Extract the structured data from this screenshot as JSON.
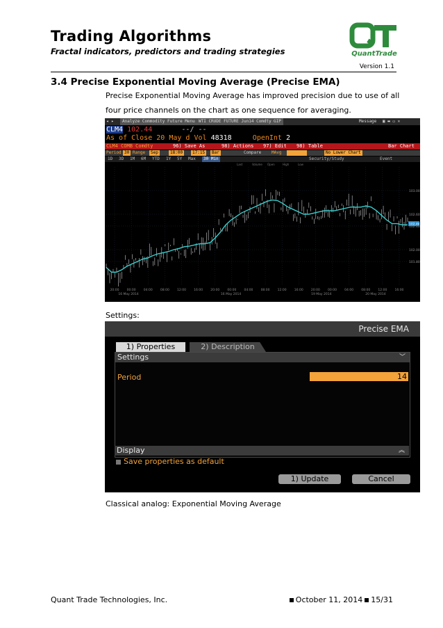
{
  "header": {
    "title": "Trading Algorithms",
    "subtitle": "Fractal indicators, predictors and trading strategies",
    "version": "Version 1.1",
    "logo_text": "QuantTrade"
  },
  "section": {
    "heading": "3.4  Precise Exponential Moving Average (Precise EMA)",
    "intro_line1": "Precise Exponential Moving Average has improved precision due to use of all",
    "intro_line2": "four price channels on the chart as one sequence for averaging.",
    "settings_label": "Settings:",
    "classical_label": "Classical analog: Exponential Moving Average"
  },
  "terminal": {
    "menu_tabs": [
      "Analyze Commodity Future Menu",
      "WTI CRUDE FUTURE Jun14 Comdty",
      "GIP"
    ],
    "message": "Message",
    "ticker": "CLM4",
    "price": "102.44",
    "change": "--/ --",
    "as_of_close": "As of Close",
    "close_date": "20 May",
    "d": "d",
    "vol_label": "Vol",
    "vol": "48318",
    "openint_label": "OpenInt",
    "openint": "2",
    "toolbar_security": "CLM4 COMB Comdty",
    "toolbar_items": [
      "96) Save As",
      "98) Actions",
      "97) Edit",
      "98) Table"
    ],
    "toolbar_right": "Bar Chart",
    "param_period_label": "Period",
    "param_period": "30",
    "param_range_label": "Range",
    "param_range_from": "Sep",
    "param_range_time": "18:00",
    "param_range_to": "17:15",
    "param_bar": "Bar",
    "param_compare": "Compare",
    "param_mavg": "MAvg",
    "param_lower": "No Lower Chart",
    "timeframes": [
      "1D",
      "3D",
      "1M",
      "6M",
      "YTD",
      "1Y",
      "5Y",
      "Max"
    ],
    "timeframe_selected": "30 Min",
    "security_study": "Security/Study",
    "event": "Event",
    "legend_items": [
      "Last",
      "Volume",
      "Open",
      "High",
      "Low"
    ],
    "date_labels": [
      "16 May 2014",
      "16 May 2014",
      "19 May 2014",
      "20 May 2014"
    ],
    "time_labels": [
      "20:00",
      "00:00",
      "04:00",
      "08:00",
      "12:00",
      "16:00",
      "20:00",
      "00:00",
      "04:00",
      "08:00",
      "12:00",
      "16:00",
      "20:00",
      "00:00",
      "04:00",
      "08:00",
      "12:00",
      "16:00"
    ],
    "price_axis_labels": [
      "103.00",
      "102.60",
      "102.40",
      "102.00",
      "101.80"
    ],
    "last_price_tag": "102.44"
  },
  "dialog": {
    "title": "Precise EMA",
    "tab_properties": "1) Properties",
    "tab_description": "2) Description",
    "settings_header": "Settings",
    "period_label": "Period",
    "period_value": "14",
    "display_header": "Display",
    "save_default": "Save properties as default",
    "update_button": "1) Update",
    "cancel_button": "Cancel",
    "chevron_down_icon": "chevron-down-double-icon",
    "chevron_up_icon": "chevron-up-double-icon"
  },
  "footer": {
    "company": "Quant Trade Technologies, Inc.",
    "date": "October 11, 2014",
    "page": "15/31"
  },
  "chart_data": {
    "type": "line",
    "title": "",
    "xlabel": "",
    "ylabel": "",
    "series": [
      {
        "name": "",
        "values": [
          101.7,
          101.62,
          101.62,
          101.66,
          101.72,
          101.76,
          101.8,
          101.84,
          101.86,
          101.9,
          101.93,
          101.95,
          101.97,
          102.0,
          102.02,
          102.05,
          102.06,
          102.08,
          102.1,
          102.1,
          102.12,
          102.2,
          102.3,
          102.42,
          102.5,
          102.56,
          102.62,
          102.66,
          102.7,
          102.74,
          102.78,
          102.82,
          102.84,
          102.83,
          102.78,
          102.72,
          102.68,
          102.64,
          102.6,
          102.6,
          102.62,
          102.64,
          102.66,
          102.66,
          102.66,
          102.68,
          102.7,
          102.72,
          102.72,
          102.72,
          102.74,
          102.72,
          102.66,
          102.58,
          102.5,
          102.44,
          102.44,
          102.42,
          102.42
        ]
      }
    ],
    "ylim": [
      101.4,
      103.4
    ],
    "grid": true
  }
}
